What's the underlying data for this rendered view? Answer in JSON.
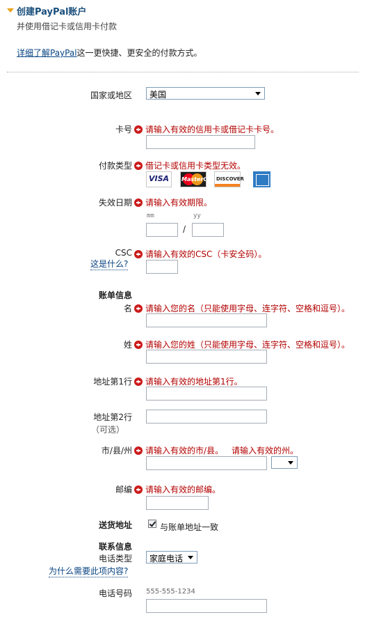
{
  "section": {
    "title": "创建PayPal账户",
    "subtitle": "并使用借记卡或信用卡付款"
  },
  "learn_more": {
    "link_text": "详细了解PayPal",
    "rest": "这一更快捷、更安全的付款方式。"
  },
  "country": {
    "label": "国家或地区",
    "value": "美国"
  },
  "card_number": {
    "label": "卡号",
    "error": "请输入有效的信用卡或借记卡卡号。"
  },
  "card_type": {
    "label": "付款类型",
    "error": "借记卡或信用卡类型无效。",
    "cards": [
      "VISA",
      "MasterCard",
      "DISCOVER",
      "AMERICAN EXPRESS"
    ]
  },
  "expiry": {
    "label": "失效日期",
    "error": "请输入有效期限。",
    "mm_hint": "mm",
    "yy_hint": "yy",
    "separator": "/"
  },
  "csc": {
    "label": "CSC",
    "help": "这是什么?",
    "error": "请输入有效的CSC（卡安全码）。"
  },
  "billing": {
    "heading": "账单信息",
    "first_name": {
      "label": "名",
      "error": "请输入您的名（只能使用字母、连字符、空格和逗号）。"
    },
    "last_name": {
      "label": "姓",
      "error": "请输入您的姓（只能使用字母、连字符、空格和逗号）。"
    },
    "address1": {
      "label": "地址第1行",
      "error": "请输入有效的地址第1行。"
    },
    "address2": {
      "label": "地址第2行",
      "optional": "（可选）"
    },
    "city": {
      "label": "市/县/州",
      "error": "请输入有效的市/县。",
      "state_error": "请输入有效的州。"
    },
    "zip": {
      "label": "邮编",
      "error": "请输入有效的邮编。"
    }
  },
  "shipping": {
    "label": "送货地址",
    "checkbox_label": "与账单地址一致",
    "checked": true
  },
  "contact": {
    "heading": "联系信息",
    "phone_type_label": "电话类型",
    "phone_type_value": "家庭电话",
    "why_help": "为什么需要此项内容?",
    "phone_label": "电话号码",
    "phone_hint": "555-555-1234"
  },
  "colors": {
    "title": "#1a4f7c",
    "error": "#b30000",
    "link": "#084482",
    "arrow": "#e8a317"
  },
  "icons": [
    "expand-arrow-icon",
    "error-icon",
    "dropdown-caret-icon",
    "checkbox-checked-icon"
  ]
}
